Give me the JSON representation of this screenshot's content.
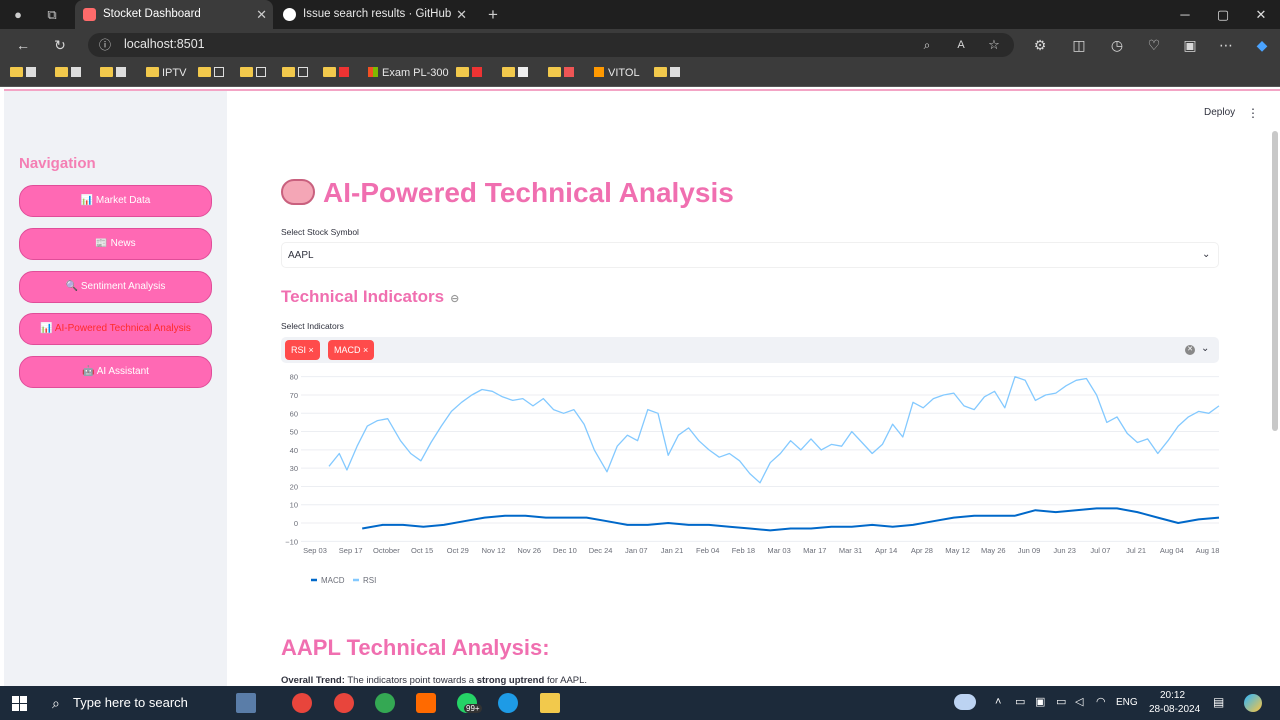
{
  "browser": {
    "tabs": [
      {
        "title": "Stocket Dashboard",
        "active": true
      },
      {
        "title": "Issue search results · GitHub",
        "active": false
      }
    ],
    "url": "localhost:8501",
    "bookmarks": [
      "IPTV",
      "Exam PL-300",
      "VITOL"
    ]
  },
  "app": {
    "deploy_label": "Deploy",
    "sidebar": {
      "title": "Navigation",
      "items": [
        {
          "label": "📊 Market Data"
        },
        {
          "label": "📰 News"
        },
        {
          "label": "🔍 Sentiment Analysis"
        },
        {
          "label": "📊 AI-Powered Technical Analysis"
        },
        {
          "label": "🤖 AI Assistant"
        }
      ]
    },
    "main": {
      "title": "AI-Powered Technical Analysis",
      "symbol_label": "Select Stock Symbol",
      "symbol_value": "AAPL",
      "indicators_header": "Technical Indicators",
      "indicators_label": "Select Indicators",
      "selected_indicators": [
        "RSI",
        "MACD"
      ],
      "analysis_header": "AAPL Technical Analysis:",
      "trend_label": "Overall Trend:",
      "trend_text_1": "The indicators point towards a",
      "trend_bold": "strong uptrend",
      "trend_text_2": "for AAPL."
    }
  },
  "taskbar": {
    "search_placeholder": "Type here to search",
    "language": "ENG",
    "time": "20:12",
    "date": "28-08-2024",
    "badge": "99+"
  },
  "colors": {
    "accent": "#ff69b4",
    "title": "#f06fb0",
    "chip": "#ff4b4b",
    "rsi": "#83c9ff",
    "macd": "#0068c9"
  },
  "chart_data": {
    "type": "line",
    "x_ticks": [
      "Sep 03",
      "Sep 17",
      "October",
      "Oct 15",
      "Oct 29",
      "Nov 12",
      "Nov 26",
      "Dec 10",
      "Dec 24",
      "Jan 07",
      "Jan 21",
      "Feb 04",
      "Feb 18",
      "Mar 03",
      "Mar 17",
      "Mar 31",
      "Apr 14",
      "Apr 28",
      "May 12",
      "May 26",
      "Jun 09",
      "Jun 23",
      "Jul 07",
      "Jul 21",
      "Aug 04",
      "Aug 18"
    ],
    "y_ticks": [
      -10,
      0,
      10,
      20,
      30,
      40,
      50,
      60,
      70,
      80
    ],
    "ylim": [
      -12,
      82
    ],
    "series": [
      {
        "name": "RSI",
        "color": "#83c9ff",
        "x": [
          "2023-09-14",
          "2023-09-18",
          "2023-09-21",
          "2023-09-25",
          "2023-09-29",
          "2023-10-03",
          "2023-10-07",
          "2023-10-12",
          "2023-10-16",
          "2023-10-20",
          "2023-10-24",
          "2023-10-28",
          "2023-11-01",
          "2023-11-05",
          "2023-11-09",
          "2023-11-13",
          "2023-11-17",
          "2023-11-21",
          "2023-11-25",
          "2023-11-29",
          "2023-12-03",
          "2023-12-07",
          "2023-12-11",
          "2023-12-15",
          "2023-12-19",
          "2023-12-23",
          "2023-12-27",
          "2024-01-01",
          "2024-01-05",
          "2024-01-09",
          "2024-01-13",
          "2024-01-17",
          "2024-01-21",
          "2024-01-25",
          "2024-01-29",
          "2024-02-02",
          "2024-02-06",
          "2024-02-10",
          "2024-02-14",
          "2024-02-18",
          "2024-02-22",
          "2024-02-26",
          "2024-03-01",
          "2024-03-05",
          "2024-03-09",
          "2024-03-13",
          "2024-03-17",
          "2024-03-21",
          "2024-03-25",
          "2024-03-29",
          "2024-04-02",
          "2024-04-06",
          "2024-04-10",
          "2024-04-14",
          "2024-04-18",
          "2024-04-22",
          "2024-04-26",
          "2024-04-30",
          "2024-05-04",
          "2024-05-08",
          "2024-05-12",
          "2024-05-16",
          "2024-05-20",
          "2024-05-24",
          "2024-05-28",
          "2024-06-01",
          "2024-06-05",
          "2024-06-09",
          "2024-06-13",
          "2024-06-17",
          "2024-06-21",
          "2024-06-25",
          "2024-06-29",
          "2024-07-03",
          "2024-07-07",
          "2024-07-11",
          "2024-07-15",
          "2024-07-19",
          "2024-07-23",
          "2024-07-27",
          "2024-07-31",
          "2024-08-04",
          "2024-08-08",
          "2024-08-12",
          "2024-08-16",
          "2024-08-20",
          "2024-08-24",
          "2024-08-28"
        ],
        "values": [
          31,
          38,
          29,
          42,
          53,
          56,
          57,
          45,
          38,
          34,
          44,
          53,
          61,
          66,
          70,
          73,
          72,
          69,
          67,
          68,
          64,
          68,
          62,
          60,
          62,
          54,
          40,
          28,
          42,
          48,
          45,
          62,
          60,
          37,
          48,
          52,
          45,
          40,
          36,
          38,
          34,
          27,
          22,
          33,
          38,
          45,
          40,
          46,
          40,
          43,
          42,
          50,
          44,
          38,
          43,
          54,
          47,
          66,
          63,
          68,
          70,
          71,
          64,
          62,
          69,
          72,
          63,
          80,
          78,
          67,
          70,
          71,
          75,
          78,
          79,
          70,
          55,
          58,
          49,
          44,
          46,
          38,
          45,
          53,
          58,
          61,
          60,
          64
        ]
      },
      {
        "name": "MACD",
        "color": "#0068c9",
        "x": [
          "2023-09-27",
          "2023-10-05",
          "2023-10-13",
          "2023-10-21",
          "2023-10-29",
          "2023-11-06",
          "2023-11-14",
          "2023-11-22",
          "2023-11-30",
          "2023-12-08",
          "2023-12-16",
          "2023-12-24",
          "2024-01-01",
          "2024-01-09",
          "2024-01-17",
          "2024-01-25",
          "2024-02-02",
          "2024-02-10",
          "2024-02-18",
          "2024-02-26",
          "2024-03-05",
          "2024-03-13",
          "2024-03-21",
          "2024-03-29",
          "2024-04-06",
          "2024-04-14",
          "2024-04-22",
          "2024-04-30",
          "2024-05-08",
          "2024-05-16",
          "2024-05-24",
          "2024-06-01",
          "2024-06-09",
          "2024-06-17",
          "2024-06-25",
          "2024-07-03",
          "2024-07-11",
          "2024-07-19",
          "2024-07-27",
          "2024-08-04",
          "2024-08-12",
          "2024-08-20",
          "2024-08-28"
        ],
        "values": [
          -3,
          -1,
          -1,
          -2,
          -1,
          1,
          3,
          4,
          4,
          3,
          3,
          3,
          1,
          -1,
          -1,
          0,
          -1,
          -1,
          -2,
          -3,
          -4,
          -3,
          -3,
          -2,
          -2,
          -1,
          -2,
          -1,
          1,
          3,
          4,
          4,
          4,
          7,
          6,
          7,
          8,
          8,
          6,
          3,
          0,
          2,
          3
        ]
      }
    ],
    "legend": [
      "MACD",
      "RSI"
    ],
    "legend_position": "bottom-left"
  }
}
